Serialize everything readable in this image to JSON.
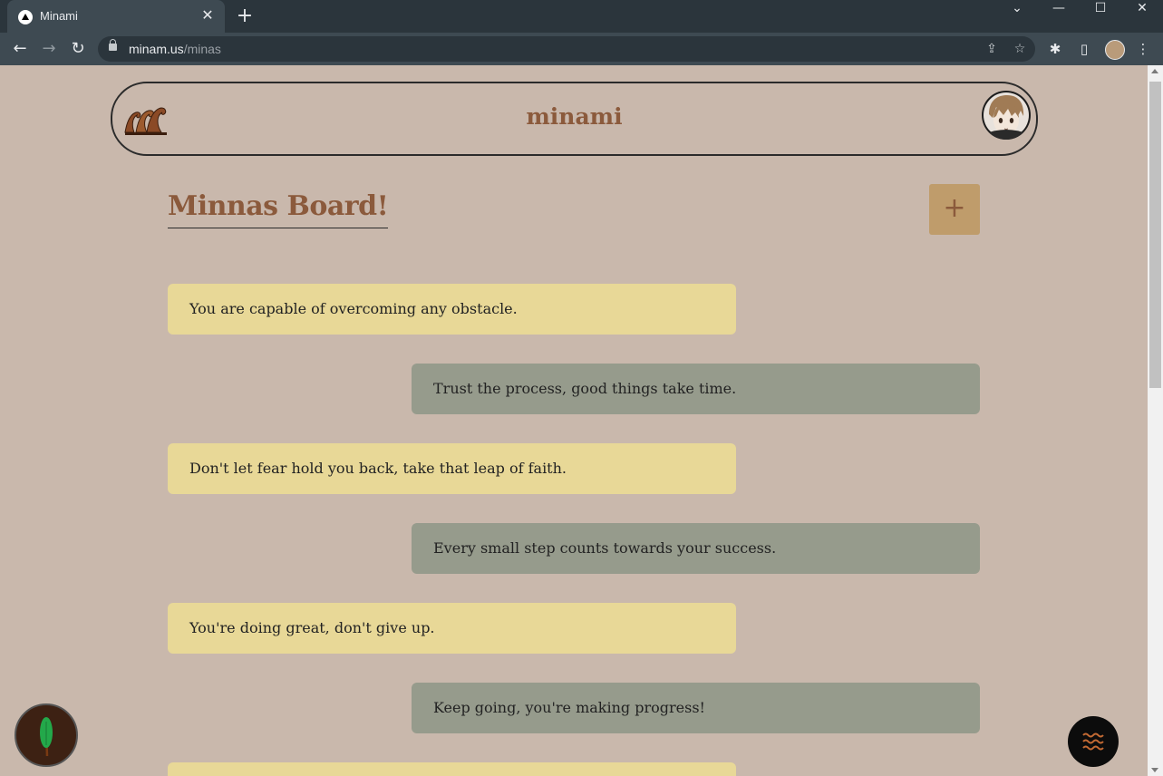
{
  "browser": {
    "tab_title": "Minami",
    "tab_close": "✕",
    "new_tab": "+",
    "url_host": "minam.us",
    "url_path": "/minas",
    "window_controls": {
      "dropdown": "⌄",
      "minimize": "—",
      "maximize": "☐",
      "close": "✕"
    }
  },
  "header": {
    "site_title": "minami",
    "logo_icon": "wave-icon",
    "avatar": "anime-avatar"
  },
  "board": {
    "title": "Minnas Board!",
    "add_label": "+"
  },
  "cards": [
    {
      "text": "You are capable of overcoming any obstacle.",
      "style": "yellow"
    },
    {
      "text": "Trust the process, good things take time.",
      "style": "gray"
    },
    {
      "text": "Don't let fear hold you back, take that leap of faith.",
      "style": "yellow"
    },
    {
      "text": "Every small step counts towards your success.",
      "style": "gray"
    },
    {
      "text": "You're doing great, don't give up.",
      "style": "yellow"
    },
    {
      "text": "Keep going, you're making progress!",
      "style": "gray"
    },
    {
      "text": "",
      "style": "yellow"
    }
  ],
  "colors": {
    "background": "#c9b8ac",
    "accent_brown": "#8b5a3c",
    "card_yellow": "#e8d897",
    "card_gray": "#969b8c",
    "add_button": "#bf9c6b"
  },
  "floating": {
    "left_icon": "tree-icon",
    "right_icon": "waves-menu-icon"
  }
}
